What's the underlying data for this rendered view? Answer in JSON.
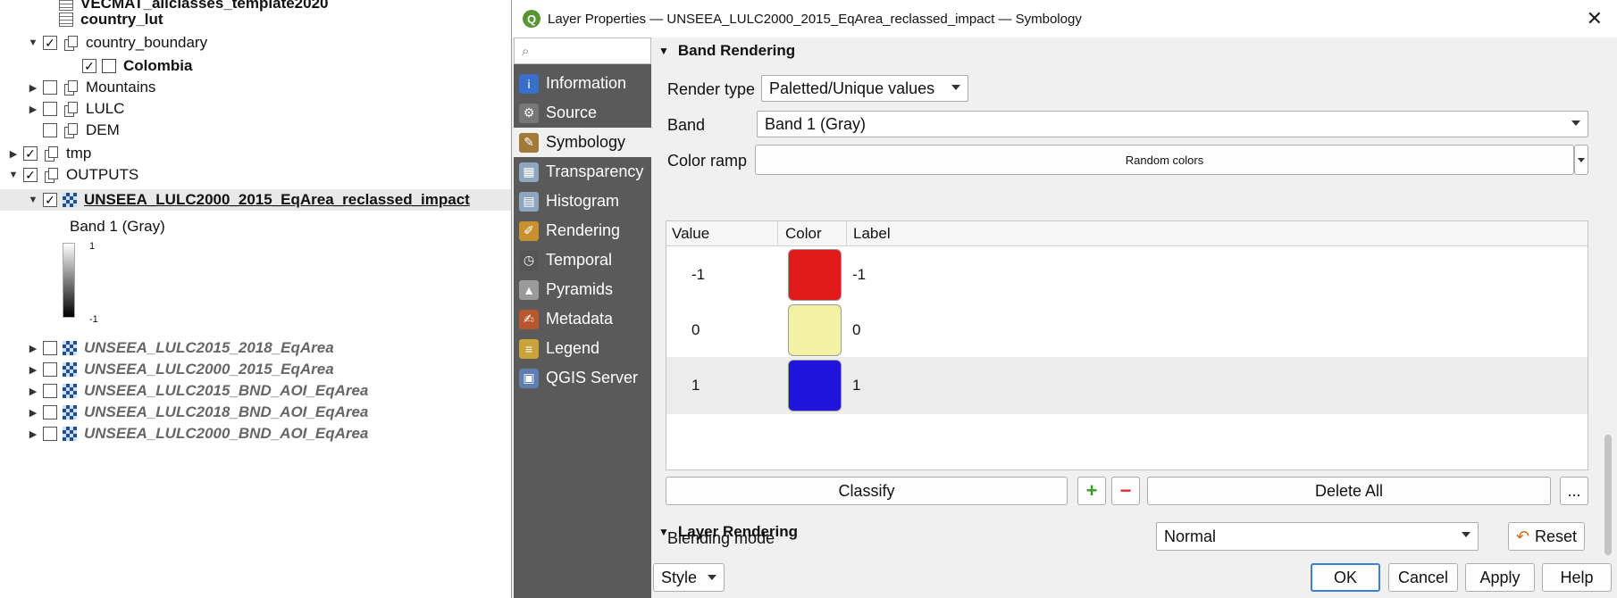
{
  "layers_panel": {
    "items": [
      {
        "label": "VECMAT_allclasses_template2020",
        "indent": 52,
        "expand": "",
        "checkbox": "none",
        "icon": "table",
        "style": "bold"
      },
      {
        "label": "country_lut",
        "indent": 52,
        "expand": "",
        "checkbox": "none",
        "icon": "table",
        "style": "bold"
      },
      {
        "label": "country_boundary",
        "indent": 30,
        "expand": "open",
        "checkbox": "on",
        "icon": "group",
        "style": ""
      },
      {
        "label": "Colombia",
        "indent": 74,
        "expand": "",
        "checkbox": "on",
        "icon": "empty",
        "style": "bold"
      },
      {
        "label": "Mountains",
        "indent": 30,
        "expand": "closed",
        "checkbox": "off",
        "icon": "group",
        "style": ""
      },
      {
        "label": "LULC",
        "indent": 30,
        "expand": "closed",
        "checkbox": "off",
        "icon": "group",
        "style": ""
      },
      {
        "label": "DEM",
        "indent": 30,
        "expand": "",
        "checkbox": "off",
        "icon": "group",
        "style": ""
      },
      {
        "label": "tmp",
        "indent": 8,
        "expand": "closed",
        "checkbox": "on",
        "icon": "group",
        "style": ""
      },
      {
        "label": "OUTPUTS",
        "indent": 8,
        "expand": "open",
        "checkbox": "on",
        "icon": "group",
        "style": ""
      },
      {
        "label": "UNSEEA_LULC2000_2015_EqArea_reclassed_impact",
        "indent": 30,
        "expand": "open",
        "checkbox": "on",
        "icon": "raster",
        "style": "bold underline",
        "selected": true
      },
      {
        "label": "UNSEEA_LULC2015_2018_EqArea",
        "indent": 30,
        "expand": "closed",
        "checkbox": "off",
        "icon": "raster",
        "style": "italic-gray"
      },
      {
        "label": "UNSEEA_LULC2000_2015_EqArea",
        "indent": 30,
        "expand": "closed",
        "checkbox": "off",
        "icon": "raster",
        "style": "italic-gray"
      },
      {
        "label": "UNSEEA_LULC2015_BND_AOI_EqArea",
        "indent": 30,
        "expand": "closed",
        "checkbox": "off",
        "icon": "raster",
        "style": "italic-gray"
      },
      {
        "label": "UNSEEA_LULC2018_BND_AOI_EqArea",
        "indent": 30,
        "expand": "closed",
        "checkbox": "off",
        "icon": "raster",
        "style": "italic-gray"
      },
      {
        "label": "UNSEEA_LULC2000_BND_AOI_EqArea",
        "indent": 30,
        "expand": "closed",
        "checkbox": "off",
        "icon": "raster",
        "style": "italic-gray"
      }
    ],
    "legend": {
      "band_label": "Band 1 (Gray)",
      "max": "1",
      "min": "-1"
    }
  },
  "dialog": {
    "title": "Layer Properties — UNSEEA_LULC2000_2015_EqArea_reclassed_impact — Symbology",
    "logo_letter": "Q",
    "close_glyph": "✕",
    "search_glyph": "⌕",
    "sidebar": [
      {
        "label": "Information",
        "icon": "information-icon",
        "color": "#3a6fc9",
        "glyph": "i"
      },
      {
        "label": "Source",
        "icon": "source-icon",
        "color": "#777777",
        "glyph": "⚙"
      },
      {
        "label": "Symbology",
        "icon": "symbology-icon",
        "color": "#a07a3a",
        "glyph": "✎",
        "active": true
      },
      {
        "label": "Transparency",
        "icon": "transparency-icon",
        "color": "#8fa6c0",
        "glyph": "▦"
      },
      {
        "label": "Histogram",
        "icon": "histogram-icon",
        "color": "#8fa6c0",
        "glyph": "▤"
      },
      {
        "label": "Rendering",
        "icon": "rendering-icon",
        "color": "#c8902e",
        "glyph": "✐"
      },
      {
        "label": "Temporal",
        "icon": "temporal-icon",
        "color": "#555555",
        "glyph": "◷"
      },
      {
        "label": "Pyramids",
        "icon": "pyramids-icon",
        "color": "#9a9a9a",
        "glyph": "▲"
      },
      {
        "label": "Metadata",
        "icon": "metadata-icon",
        "color": "#b8572e",
        "glyph": "✍"
      },
      {
        "label": "Legend",
        "icon": "legend-icon",
        "color": "#c9a23a",
        "glyph": "≡"
      },
      {
        "label": "QGIS Server",
        "icon": "qgis-server-icon",
        "color": "#5d7fb0",
        "glyph": "▣"
      }
    ],
    "band_rendering": {
      "header": "Band Rendering",
      "render_type_label": "Render type",
      "render_type_value": "Paletted/Unique values",
      "band_label": "Band",
      "band_value": "Band 1 (Gray)",
      "color_ramp_label": "Color ramp",
      "color_ramp_value": "Random colors",
      "table": {
        "headers": [
          "Value",
          "Color",
          "Label"
        ],
        "rows": [
          {
            "value": "-1",
            "color": "#e31a1c",
            "label": "-1"
          },
          {
            "value": "0",
            "color": "#f2f2a2",
            "label": "0"
          },
          {
            "value": "1",
            "color": "#1f14d9",
            "label": "1"
          }
        ]
      },
      "classify_label": "Classify",
      "add_glyph": "+",
      "remove_glyph": "−",
      "delete_all_label": "Delete All",
      "more_label": "..."
    },
    "layer_rendering": {
      "header": "Layer Rendering",
      "blending_label": "Blending mode",
      "blending_value": "Normal",
      "reset_label": "Reset"
    },
    "footer": {
      "style_label": "Style",
      "ok_label": "OK",
      "cancel_label": "Cancel",
      "apply_label": "Apply",
      "help_label": "Help"
    }
  }
}
